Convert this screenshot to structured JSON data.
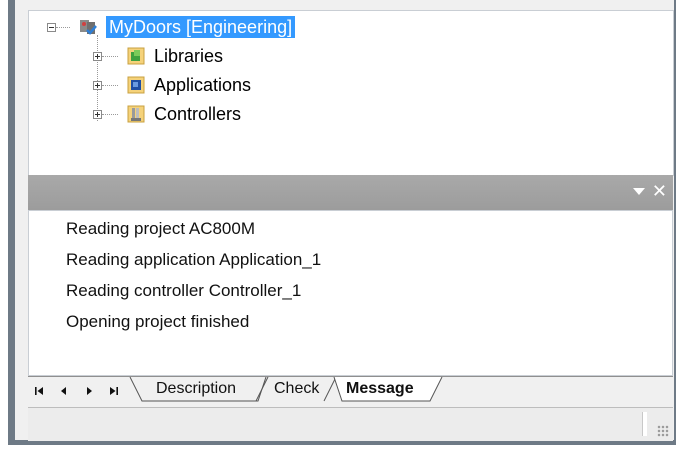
{
  "tree": {
    "root_label": "MyDoors [Engineering]",
    "children": [
      {
        "label": "Libraries",
        "icon": "library-icon"
      },
      {
        "label": "Applications",
        "icon": "application-icon"
      },
      {
        "label": "Controllers",
        "icon": "controller-icon"
      }
    ]
  },
  "panel": {
    "close_glyph": "✕"
  },
  "messages": [
    "Reading project AC800M",
    "Reading application Application_1",
    "Reading controller Controller_1",
    "Opening project finished"
  ],
  "tabs": [
    {
      "label": "Description",
      "active": false
    },
    {
      "label": "Check",
      "active": false
    },
    {
      "label": "Message",
      "active": true
    }
  ],
  "colors": {
    "selection": "#3399ff",
    "panel_bar": "#a0a0a0",
    "frame": "#6e7a86"
  }
}
